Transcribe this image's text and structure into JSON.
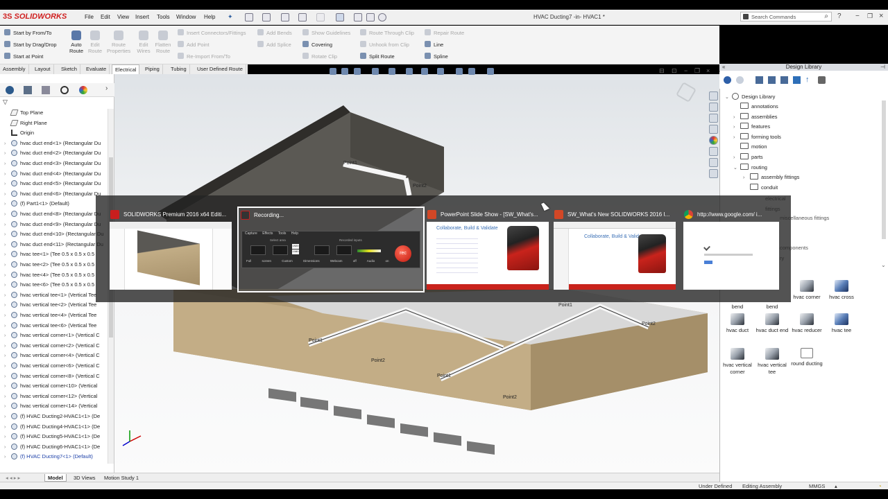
{
  "app": {
    "logo": "SOLIDWORKS",
    "window_title": "HVAC Ducting7 -in- HVAC1 *",
    "search_placeholder": "Search Commands",
    "menus": [
      "File",
      "Edit",
      "View",
      "Insert",
      "Tools",
      "Window",
      "Help"
    ]
  },
  "ribbon": {
    "start_buttons": [
      "Start by From/To",
      "Start by Drag/Drop",
      "Start at Point"
    ],
    "big_buttons": [
      {
        "label": "Auto Route",
        "enabled": true
      },
      {
        "label": "Edit Route",
        "enabled": false
      },
      {
        "label": "Route Properties",
        "enabled": false
      },
      {
        "label": "Edit Wires",
        "enabled": false
      },
      {
        "label": "Flatten Route",
        "enabled": false
      }
    ],
    "col1": [
      {
        "label": "Insert Connectors/Fittings",
        "enabled": false
      },
      {
        "label": "Add Point",
        "enabled": false
      },
      {
        "label": "Re-Import From/To",
        "enabled": false
      }
    ],
    "col2": [
      {
        "label": "Add Bends",
        "enabled": false
      },
      {
        "label": "Add Splice",
        "enabled": false
      }
    ],
    "col3": [
      {
        "label": "Show Guidelines",
        "enabled": false
      },
      {
        "label": "Covering",
        "enabled": true
      },
      {
        "label": "Rotate Clip",
        "enabled": false
      }
    ],
    "col4": [
      {
        "label": "Route Through Clip",
        "enabled": false
      },
      {
        "label": "Unhook from Clip",
        "enabled": false
      },
      {
        "label": "Split Route",
        "enabled": true
      }
    ],
    "col5": [
      {
        "label": "Repair Route",
        "enabled": false
      },
      {
        "label": "Line",
        "enabled": true
      },
      {
        "label": "Spline",
        "enabled": true
      }
    ]
  },
  "tabs": [
    "Assembly",
    "Layout",
    "Sketch",
    "Evaluate",
    "Electrical",
    "Piping",
    "Tubing",
    "User Defined Route"
  ],
  "active_tab": "Electrical",
  "feature_tree": [
    {
      "label": "Top Plane",
      "kind": "plane"
    },
    {
      "label": "Right Plane",
      "kind": "plane"
    },
    {
      "label": "Origin",
      "kind": "origin"
    },
    {
      "label": "hvac duct end<1> (Rectangular Du",
      "kind": "part"
    },
    {
      "label": "hvac duct end<2> (Rectangular Du",
      "kind": "part"
    },
    {
      "label": "hvac duct end<3> (Rectangular Du",
      "kind": "part"
    },
    {
      "label": "hvac duct end<4> (Rectangular Du",
      "kind": "part"
    },
    {
      "label": "hvac duct end<5> (Rectangular Du",
      "kind": "part"
    },
    {
      "label": "hvac duct end<6> (Rectangular Du",
      "kind": "part"
    },
    {
      "label": "(f) Part1<1> (Default)",
      "kind": "part"
    },
    {
      "label": "hvac duct end<8> (Rectangular Du",
      "kind": "part"
    },
    {
      "label": "hvac duct end<9> (Rectangular Du",
      "kind": "part"
    },
    {
      "label": "hvac duct end<10> (Rectangular Du",
      "kind": "part"
    },
    {
      "label": "hvac duct end<11> (Rectangular Du",
      "kind": "part"
    },
    {
      "label": "hvac tee<1> (Tee 0.5 x 0.5 x 0.5",
      "kind": "part"
    },
    {
      "label": "hvac tee<2> (Tee 0.5 x 0.5 x 0.5",
      "kind": "part"
    },
    {
      "label": "hvac tee<4> (Tee 0.5 x 0.5 x 0.5",
      "kind": "part"
    },
    {
      "label": "hvac tee<6> (Tee 0.5 x 0.5 x 0.5",
      "kind": "part"
    },
    {
      "label": "hvac vertical tee<1> (Vertical Tee",
      "kind": "part"
    },
    {
      "label": "hvac vertical tee<2> (Vertical Tee",
      "kind": "part"
    },
    {
      "label": "hvac vertical tee<4> (Vertical Tee",
      "kind": "part"
    },
    {
      "label": "hvac vertical tee<6> (Vertical Tee",
      "kind": "part"
    },
    {
      "label": "hvac vertical corner<1> (Vertical C",
      "kind": "part"
    },
    {
      "label": "hvac vertical corner<2> (Vertical C",
      "kind": "part"
    },
    {
      "label": "hvac vertical corner<4> (Vertical C",
      "kind": "part"
    },
    {
      "label": "hvac vertical corner<6> (Vertical C",
      "kind": "part"
    },
    {
      "label": "hvac vertical corner<8> (Vertical C",
      "kind": "part"
    },
    {
      "label": "hvac vertical corner<10> (Vertical",
      "kind": "part"
    },
    {
      "label": "hvac vertical corner<12> (Vertical",
      "kind": "part"
    },
    {
      "label": "hvac vertical corner<14> (Vertical",
      "kind": "part"
    },
    {
      "label": "(f) HVAC Ducting2-HVAC1<1> (De",
      "kind": "asm"
    },
    {
      "label": "(f) HVAC Ducting4-HVAC1<1> (De",
      "kind": "asm"
    },
    {
      "label": "(f) HVAC Ducting5-HVAC1<1> (De",
      "kind": "asm"
    },
    {
      "label": "(f) HVAC Ducting6-HVAC1<1> (De",
      "kind": "asm"
    },
    {
      "label": "(f) HVAC Ducting7<1> (Default)",
      "kind": "asm-active"
    }
  ],
  "bottom_tabs": [
    "Model",
    "3D Views",
    "Motion Study 1"
  ],
  "status": {
    "left": "Under Defined",
    "mode": "Editing Assembly",
    "units": "MMGS"
  },
  "design_library": {
    "title": "Design Library",
    "root": "Design Library",
    "folders": [
      {
        "label": "annotations",
        "indent": 1,
        "expander": ""
      },
      {
        "label": "assemblies",
        "indent": 1,
        "expander": "›"
      },
      {
        "label": "features",
        "indent": 1,
        "expander": "›"
      },
      {
        "label": "forming tools",
        "indent": 1,
        "expander": "›"
      },
      {
        "label": "motion",
        "indent": 1,
        "expander": ""
      },
      {
        "label": "parts",
        "indent": 1,
        "expander": "›"
      },
      {
        "label": "routing",
        "indent": 1,
        "expander": "⌄"
      },
      {
        "label": "assembly fittings",
        "indent": 2,
        "expander": "›"
      },
      {
        "label": "conduit",
        "indent": 2,
        "expander": ""
      }
    ],
    "partial_labels": [
      "electrical",
      "fittings",
      "miscellaneous fittings",
      "components",
      "ry"
    ],
    "tiles_row1": [
      "bend",
      "bend",
      "hvac corner",
      "hvac cross"
    ],
    "tiles": [
      {
        "label": "hvac duct",
        "style": "dark"
      },
      {
        "label": "hvac duct end",
        "style": "dark"
      },
      {
        "label": "hvac reducer",
        "style": "dark"
      },
      {
        "label": "hvac tee",
        "style": "blue"
      },
      {
        "label": "hvac vertical corner",
        "style": "dark"
      },
      {
        "label": "hvac vertical tee",
        "style": "dark"
      },
      {
        "label": "round ducting",
        "style": "folder"
      }
    ]
  },
  "model_labels": [
    "Point1",
    "Point2",
    "Point1",
    "Point2",
    "Point1",
    "Point2",
    "Point1",
    "Point2"
  ],
  "task_switcher": {
    "windows": [
      {
        "title": "SOLIDWORKS Premium 2016 x64 Editi...",
        "app": "solidworks",
        "selected": false
      },
      {
        "title": "Recording...",
        "app": "recorder",
        "selected": true
      },
      {
        "title": "PowerPoint Slide Show - [SW_What's...",
        "app": "powerpoint",
        "selected": false
      },
      {
        "title": "SW_What's New SOLIDWORKS 2016 I...",
        "app": "powerpoint",
        "selected": false
      },
      {
        "title": "http://www.google.com/ i...",
        "app": "chrome",
        "selected": false
      }
    ],
    "recorder": {
      "menu": [
        "Capture",
        "Effects",
        "Tools",
        "Help"
      ],
      "select_area": "Select area",
      "recorded_inputs": "Recorded inputs",
      "buttons": [
        "Full screen",
        "Custom",
        "Dimensions",
        "Webcam off",
        "Audio on"
      ],
      "dims": [
        "1920",
        "1080"
      ],
      "rec_label": "rec"
    },
    "ppt_title": "Collaborate, Build & Validate"
  },
  "colors": {
    "accent_red": "#d02020",
    "brick": "#b4a37e",
    "roof": "#3e3c37"
  }
}
